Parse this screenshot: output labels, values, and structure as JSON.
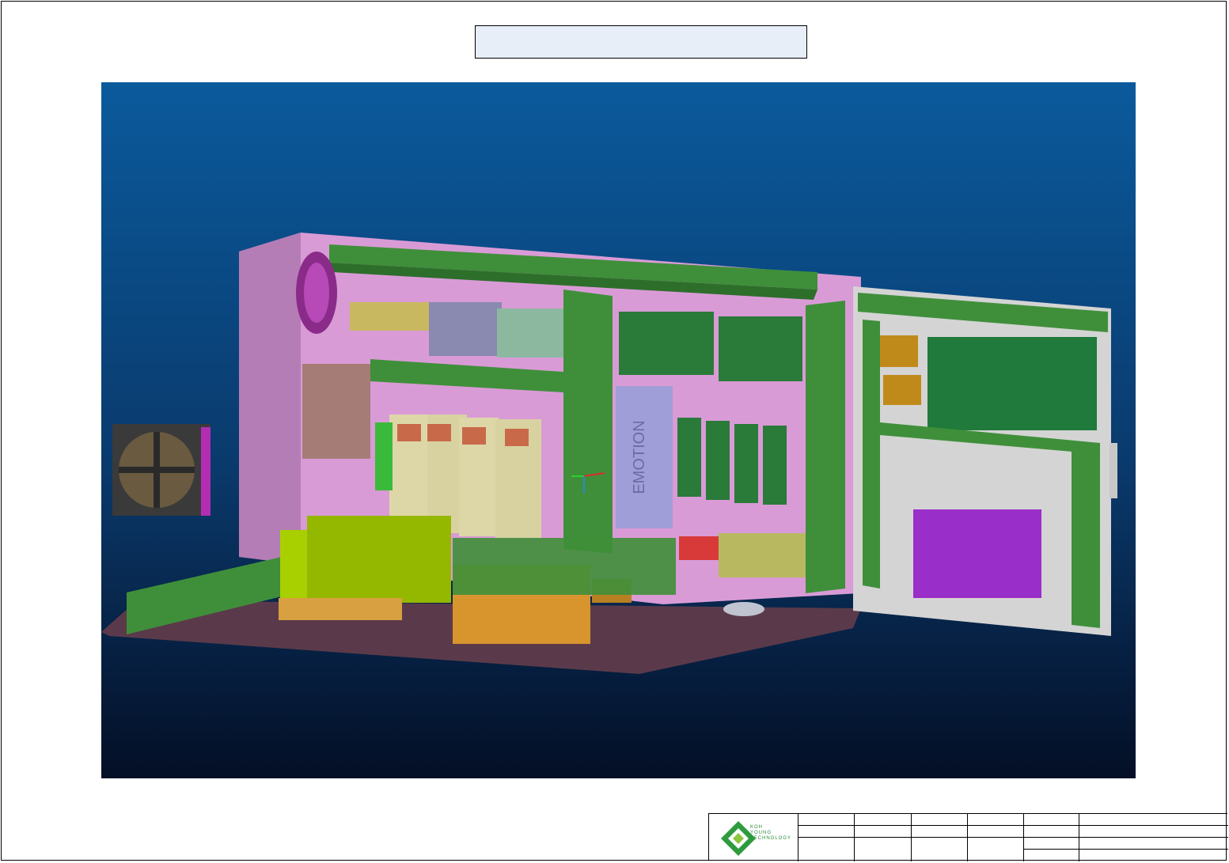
{
  "sheet": {
    "title_text": ""
  },
  "model": {
    "brand_label": "EMOTION"
  },
  "colors": {
    "panel_pink": "#d99bd6",
    "rail_green": "#3f8f3a",
    "board_green": "#1f7a3b",
    "chassis_brown": "#5a3a4a",
    "bg_top": "#0b5a9c",
    "bg_bottom": "#040f26"
  },
  "title_block": {
    "company_line1": "KOH",
    "company_line2": "YOUNG",
    "company_line3": "TECHNOLOGY"
  }
}
